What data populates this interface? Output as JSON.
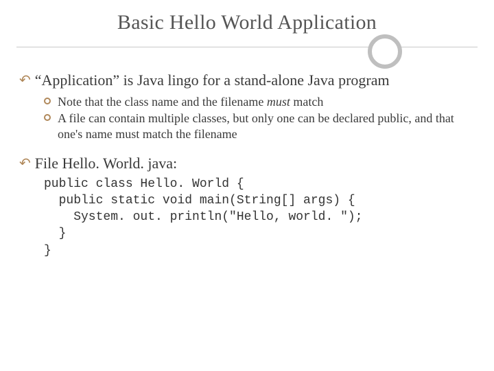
{
  "title": "Basic Hello World Application",
  "bullets": [
    {
      "text": "“Application” is Java lingo for a stand-alone Java program",
      "sub": [
        {
          "pre": "Note that the class name and the filename ",
          "em": "must",
          "post": " match"
        },
        {
          "pre": "A file can contain multiple classes, but only one can be declared public, and that one's name must match the filename",
          "em": "",
          "post": ""
        }
      ]
    },
    {
      "text": "File Hello. World. java:",
      "sub": []
    }
  ],
  "code": "public class Hello. World {\n  public static void main(String[] args) {\n    System. out. println(\"Hello, world. \");\n  }\n}"
}
